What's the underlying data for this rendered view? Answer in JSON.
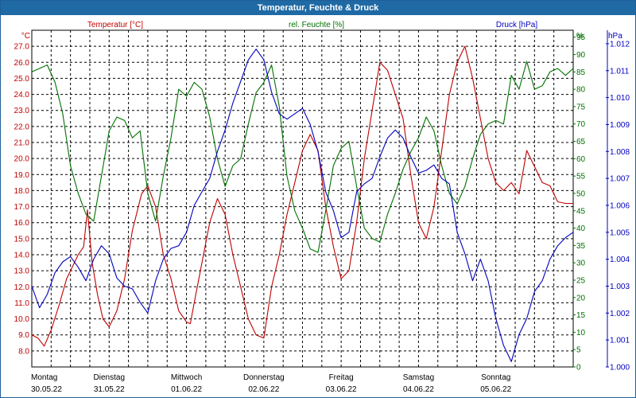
{
  "chart_data": {
    "type": "line",
    "title": "Temperatur, Feuchte & Druck",
    "series_labels": {
      "temperature": "Temperatur [°C]",
      "humidity": "rel. Feuchte [%]",
      "pressure": "Druck [hPa]"
    },
    "axes": {
      "left": {
        "unit": "°C",
        "min": 7.0,
        "max": 28.0,
        "ticks": [
          "8.0",
          "9.0",
          "10.0",
          "11.0",
          "12.0",
          "13.0",
          "14.0",
          "15.0",
          "16.0",
          "17.0",
          "18.0",
          "19.0",
          "20.0",
          "21.0",
          "22.0",
          "23.0",
          "24.0",
          "25.0",
          "26.0",
          "27.0"
        ]
      },
      "mid": {
        "unit": "%",
        "min": 0,
        "max": 97,
        "ticks": [
          "0",
          "5",
          "10",
          "15",
          "20",
          "25",
          "30",
          "35",
          "40",
          "45",
          "50",
          "55",
          "60",
          "65",
          "70",
          "75",
          "80",
          "85",
          "90",
          "95"
        ]
      },
      "right": {
        "unit": "hPa",
        "min": 1.0,
        "max": 1.0125,
        "ticks": [
          "1.000",
          "1.001",
          "1.002",
          "1.003",
          "1.004",
          "1.005",
          "1.006",
          "1.007",
          "1.008",
          "1.009",
          "1.010",
          "1.011",
          "1.012"
        ]
      }
    },
    "x": {
      "min": 0,
      "max": 7,
      "day_labels": [
        {
          "day": "Montag",
          "date": "30.05.22"
        },
        {
          "day": "Dienstag",
          "date": "31.05.22"
        },
        {
          "day": "Mittwoch",
          "date": "01.06.22"
        },
        {
          "day": "Donnerstag",
          "date": "02.06.22"
        },
        {
          "day": "Freitag",
          "date": "03.06.22"
        },
        {
          "day": "Samstag",
          "date": "04.06.22"
        },
        {
          "day": "Sonntag",
          "date": "05.06.22"
        }
      ]
    },
    "colors": {
      "temperature": "#c00000",
      "humidity": "#007000",
      "pressure": "#0000c0",
      "grid": "#000000",
      "title_bar": "#1f6aa5"
    },
    "grid": true,
    "series": [
      {
        "key": "temperature",
        "x": [
          0,
          0.08,
          0.16,
          0.25,
          0.35,
          0.45,
          0.52,
          0.6,
          0.67,
          0.72,
          0.78,
          0.85,
          0.92,
          1.0,
          1.1,
          1.2,
          1.3,
          1.42,
          1.5,
          1.6,
          1.7,
          1.8,
          1.9,
          2.0,
          2.05,
          2.1,
          2.2,
          2.3,
          2.4,
          2.5,
          2.6,
          2.7,
          2.8,
          2.9,
          3.0,
          3.1,
          3.2,
          3.3,
          3.4,
          3.5,
          3.6,
          3.7,
          3.8,
          3.9,
          4.0,
          4.1,
          4.2,
          4.3,
          4.4,
          4.5,
          4.6,
          4.7,
          4.8,
          4.9,
          5.0,
          5.1,
          5.2,
          5.3,
          5.4,
          5.5,
          5.6,
          5.7,
          5.8,
          5.9,
          6.0,
          6.1,
          6.2,
          6.3,
          6.4,
          6.5,
          6.6,
          6.7,
          6.8,
          6.9,
          7.0
        ],
        "y": [
          9.0,
          8.8,
          8.3,
          9.3,
          10.8,
          12.5,
          13.2,
          14.0,
          14.5,
          16.8,
          13.5,
          11.5,
          10.0,
          9.5,
          10.5,
          12.5,
          15.5,
          17.8,
          18.3,
          17.0,
          14.0,
          12.5,
          10.5,
          9.8,
          9.7,
          11.0,
          13.5,
          16.0,
          17.5,
          16.5,
          14.0,
          12.0,
          10.0,
          9.0,
          8.8,
          12.0,
          14.0,
          16.5,
          18.5,
          20.5,
          21.5,
          20.5,
          17.0,
          14.5,
          12.5,
          13.0,
          16.0,
          20.0,
          23.0,
          26.0,
          25.5,
          24.0,
          22.5,
          19.0,
          16.0,
          15.0,
          17.0,
          20.5,
          24.0,
          26.0,
          27.0,
          25.0,
          22.5,
          20.0,
          18.5,
          18.0,
          18.5,
          17.8,
          20.5,
          19.5,
          18.5,
          18.3,
          17.3,
          17.2,
          17.2
        ]
      },
      {
        "key": "humidity",
        "x": [
          0,
          0.1,
          0.2,
          0.3,
          0.4,
          0.5,
          0.6,
          0.7,
          0.8,
          0.9,
          1.0,
          1.1,
          1.2,
          1.3,
          1.4,
          1.5,
          1.6,
          1.7,
          1.8,
          1.9,
          2.0,
          2.1,
          2.2,
          2.3,
          2.4,
          2.5,
          2.6,
          2.7,
          2.8,
          2.9,
          3.0,
          3.1,
          3.2,
          3.3,
          3.4,
          3.5,
          3.6,
          3.7,
          3.8,
          3.9,
          4.0,
          4.1,
          4.2,
          4.3,
          4.4,
          4.5,
          4.6,
          4.7,
          4.8,
          4.9,
          5.0,
          5.1,
          5.2,
          5.3,
          5.4,
          5.5,
          5.6,
          5.7,
          5.8,
          5.9,
          6.0,
          6.1,
          6.2,
          6.3,
          6.4,
          6.5,
          6.6,
          6.7,
          6.8,
          6.9,
          7.0
        ],
        "y": [
          85,
          86,
          87,
          82,
          73,
          58,
          50,
          44,
          42,
          55,
          68,
          72,
          71,
          66,
          68,
          50,
          42,
          55,
          66,
          80,
          78,
          82,
          80,
          72,
          60,
          52,
          58,
          60,
          70,
          79,
          82,
          87,
          75,
          55,
          45,
          40,
          34,
          33,
          45,
          58,
          63,
          65,
          52,
          40,
          37,
          36,
          44,
          50,
          57,
          62,
          66,
          72,
          68,
          58,
          50,
          47,
          52,
          60,
          67,
          70,
          71,
          70,
          84,
          80,
          88,
          80,
          81,
          85,
          86,
          84,
          86
        ]
      },
      {
        "key": "pressure",
        "x": [
          0,
          0.1,
          0.2,
          0.3,
          0.4,
          0.5,
          0.6,
          0.7,
          0.8,
          0.9,
          1.0,
          1.1,
          1.2,
          1.3,
          1.4,
          1.5,
          1.6,
          1.7,
          1.8,
          1.9,
          2.0,
          2.1,
          2.2,
          2.3,
          2.4,
          2.5,
          2.6,
          2.7,
          2.8,
          2.9,
          3.0,
          3.1,
          3.2,
          3.3,
          3.4,
          3.5,
          3.6,
          3.7,
          3.8,
          3.9,
          4.0,
          4.1,
          4.2,
          4.3,
          4.4,
          4.5,
          4.6,
          4.7,
          4.8,
          4.9,
          5.0,
          5.1,
          5.2,
          5.3,
          5.4,
          5.5,
          5.6,
          5.7,
          5.8,
          5.9,
          6.0,
          6.1,
          6.2,
          6.3,
          6.4,
          6.5,
          6.6,
          6.7,
          6.8,
          6.9,
          7.0
        ],
        "y": [
          1.003,
          1.0022,
          1.0027,
          1.0035,
          1.0039,
          1.0041,
          1.0037,
          1.0032,
          1.004,
          1.0045,
          1.0042,
          1.0033,
          1.003,
          1.0029,
          1.0024,
          1.002,
          1.0032,
          1.004,
          1.0044,
          1.0045,
          1.005,
          1.006,
          1.0065,
          1.007,
          1.008,
          1.0088,
          1.0098,
          1.0106,
          1.0114,
          1.0118,
          1.0114,
          1.0102,
          1.0094,
          1.0092,
          1.0094,
          1.0096,
          1.009,
          1.008,
          1.0065,
          1.0058,
          1.0048,
          1.005,
          1.0065,
          1.0068,
          1.007,
          1.0078,
          1.0085,
          1.0088,
          1.0085,
          1.0078,
          1.0072,
          1.0073,
          1.0075,
          1.007,
          1.0068,
          1.005,
          1.0042,
          1.0032,
          1.004,
          1.0032,
          1.0018,
          1.0008,
          1.0002,
          1.0012,
          1.0018,
          1.0028,
          1.0032,
          1.004,
          1.0045,
          1.0048,
          1.005
        ]
      }
    ]
  }
}
